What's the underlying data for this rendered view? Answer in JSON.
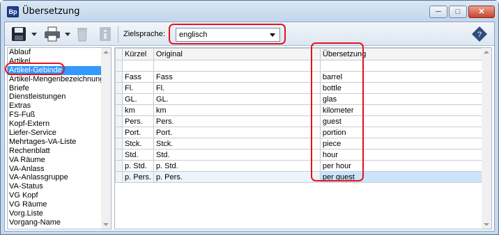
{
  "window": {
    "title": "Übersetzung",
    "app_icon_text": "Bp",
    "min_label": "─",
    "max_label": "□",
    "close_label": "✕"
  },
  "toolbar": {
    "icons": [
      "save-icon",
      "print-icon",
      "delete-icon",
      "info-icon",
      "help-book-icon"
    ],
    "target_language_label": "Zielsprache:",
    "target_language_value": "englisch"
  },
  "left_list": {
    "items": [
      "Ablauf",
      "Artikel",
      "Artikel-Gebinde",
      "Artikel-Mengenbezeichnung",
      "Briefe",
      "Dienstleistungen",
      "Extras",
      "FS-Fuß",
      "Kopf-Extern",
      "Liefer-Service",
      "Mehrtages-VA-Liste",
      "Rechenblatt",
      "VA Räume",
      "VA-Anlass",
      "VA-Anlassgruppe",
      "VA-Status",
      "VG Kopf",
      "VG Räume",
      "Vorg.Liste",
      "Vorgang-Name"
    ],
    "selected_index": 2
  },
  "grid": {
    "columns": [
      "Kürzel",
      "Original",
      "Übersetzung"
    ],
    "rows": [
      [
        "",
        "",
        ""
      ],
      [
        "Fass",
        "Fass",
        "barrel"
      ],
      [
        "Fl.",
        "Fl.",
        "bottle"
      ],
      [
        "GL.",
        "GL.",
        "glas"
      ],
      [
        "km",
        "km",
        "kilometer"
      ],
      [
        "Pers.",
        "Pers.",
        "guest"
      ],
      [
        "Port.",
        "Port.",
        "portion"
      ],
      [
        "Stck.",
        "Stck.",
        "piece"
      ],
      [
        "Std.",
        "Std.",
        "hour"
      ],
      [
        "p. Std.",
        "p. Std.",
        "per hour"
      ],
      [
        "p. Pers.",
        "p. Pers.",
        "per guest"
      ]
    ],
    "selected_row_index": 10
  },
  "colors": {
    "selection_blue": "#3399ff",
    "annotation_red": "#e3131b",
    "selected_cell": "#cce4fa"
  }
}
